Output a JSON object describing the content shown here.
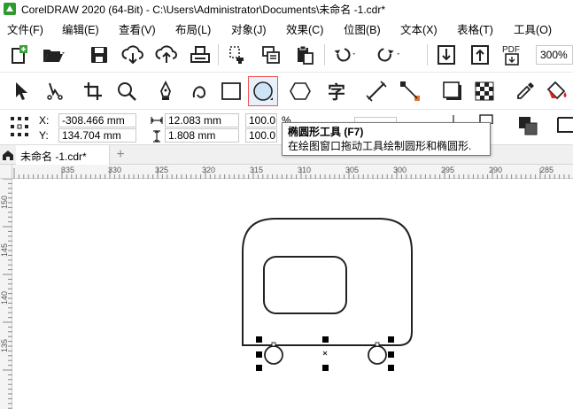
{
  "title": "CorelDRAW 2020 (64-Bit) - C:\\Users\\Administrator\\Documents\\未命名 -1.cdr*",
  "menu": [
    "文件(F)",
    "编辑(E)",
    "查看(V)",
    "布局(L)",
    "对象(J)",
    "效果(C)",
    "位图(B)",
    "文本(X)",
    "表格(T)",
    "工具(O)"
  ],
  "zoom": "300%",
  "toolbar_icons": [
    "new-document",
    "open-folder",
    "save",
    "cloud-import",
    "cloud-export",
    "print",
    "cut",
    "copy",
    "paste",
    "undo",
    "redo",
    "import",
    "export",
    "publish-pdf"
  ],
  "tools": [
    "pick",
    "freehand-pick",
    "crop",
    "zoom",
    "pen",
    "curve",
    "rectangle",
    "ellipse",
    "polygon",
    "text",
    "dimension",
    "connector",
    "drop-shadow",
    "transparency",
    "eyedropper",
    "interactive-fill"
  ],
  "active_tool": "ellipse",
  "properties": {
    "x_label": "X:",
    "x_value": "-308.466 mm",
    "y_label": "Y:",
    "y_value": "134.704 mm",
    "width_value": "12.083 mm",
    "height_value": "1.808 mm",
    "scale_w": "100.0",
    "scale_h": "100.0",
    "percent": "%"
  },
  "tooltip": {
    "title": "椭圆形工具 (F7)",
    "description": "在绘图窗口拖动工具绘制圆形和椭圆形."
  },
  "document_tab": "未命名 -1.cdr*",
  "ruler_h_labels": [
    "335",
    "330",
    "325",
    "320",
    "315",
    "310",
    "305",
    "300",
    "295",
    "290",
    "285"
  ],
  "ruler_v_labels": [
    "150",
    "145",
    "140",
    "135"
  ],
  "colors": {
    "active_tool_border": "#ef5555",
    "active_tool_fill": "#e8f1fb",
    "tab_bg": "#f0f0f0"
  }
}
